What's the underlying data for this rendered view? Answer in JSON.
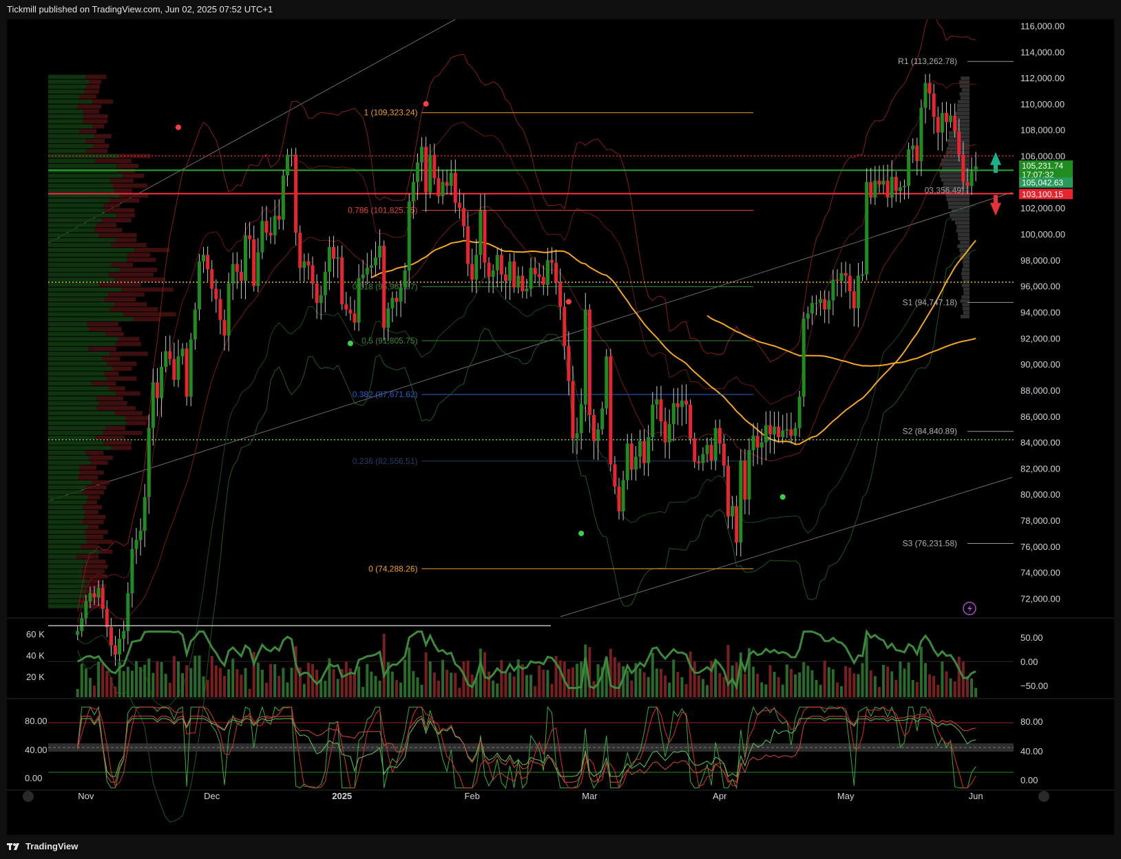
{
  "header": {
    "text": "Tickmill published on TradingView.com, Jun 02, 2025 07:52 UTC+1"
  },
  "footer": {
    "brand": "TradingView"
  },
  "colors": {
    "up": "#1e8c1e",
    "down": "#e8252e",
    "grid": "#1c1c1c",
    "fib_orange": "#f0a020",
    "fib_red": "#e8403a",
    "fib_green": "#3a8a3a",
    "fib_blue": "#2a5fd0",
    "fib_dark": "#20406a",
    "ma_orange": "#f5a623",
    "bb_red": "#8a1c1c",
    "bb_green": "#1f5a1f",
    "channel": "#8a8a8a"
  },
  "chart_data": [
    {
      "type": "candlestick",
      "symbol_note": "BTC daily",
      "price_axis": {
        "ticks": [
          "116,000.00",
          "114,000.00",
          "112,000.00",
          "110,000.00",
          "108,000.00",
          "106,000.00",
          "104,000.00",
          "102,000.00",
          "100,000.00",
          "98,000.00",
          "96,000.00",
          "94,000.00",
          "92,000.00",
          "90,000.00",
          "88,000.00",
          "86,000.00",
          "84,000.00",
          "82,000.00",
          "80,000.00",
          "78,000.00",
          "76,000.00",
          "74,000.00",
          "72,000.00"
        ],
        "ylim": [
          70600,
          116500
        ]
      },
      "time_axis": {
        "labels": [
          "Nov",
          "Dec",
          "2025",
          "Feb",
          "Mar",
          "Apr",
          "May",
          "Jun"
        ],
        "xlim": [
          "2024-10-23",
          "2025-06-10"
        ]
      },
      "price_labels": [
        {
          "text": "105,231.74",
          "sub": "17:07:32",
          "value": 105231.74,
          "color": "#1e8c1e"
        },
        {
          "text": "105,042.63",
          "value": 105042.63,
          "color": "#2a9a5a"
        },
        {
          "text": "103,100.15",
          "value": 103100.15,
          "color": "#e8252e"
        }
      ],
      "fib_levels": [
        {
          "label": "1 (109,323.24)",
          "value": 109323.24,
          "color": "#f0a020"
        },
        {
          "label": "0.786 (101,825.75)",
          "value": 101825.75,
          "color": "#e8403a"
        },
        {
          "label": "0.618 (95,961.87)",
          "value": 95961.87,
          "color": "#3a8a3a"
        },
        {
          "label": "0.5 (91,805.75)",
          "value": 91805.75,
          "color": "#3a8a3a"
        },
        {
          "label": "0.382 (87,671.62)",
          "value": 87671.62,
          "color": "#2a5fd0"
        },
        {
          "label": "0.236 (82,556.51)",
          "value": 82556.51,
          "color": "#20406a"
        },
        {
          "label": "0 (74,288.26)",
          "value": 74288.26,
          "color": "#f0a020"
        }
      ],
      "pivots": [
        {
          "label": "R1 (113,262.78)",
          "value": 113262.78
        },
        {
          "label": "S1 (94,747.18)",
          "value": 94747.18
        },
        {
          "label": "S2 (84,840.89)",
          "value": 84840.89
        },
        {
          "label": "S3 (76,231.58)",
          "value": 76231.58
        }
      ],
      "overlapped_label": {
        "text": "03,356.49)",
        "value": 103356.49
      },
      "horizontal_lines": [
        {
          "value": 106000,
          "style": "dotted",
          "color": "#e8252e"
        },
        {
          "value": 104900,
          "style": "solid",
          "color": "#2aaa2a"
        },
        {
          "value": 103100,
          "style": "solid",
          "color": "#ff3040"
        },
        {
          "value": 96300,
          "style": "dotted",
          "color": "#f0c020"
        },
        {
          "value": 84200,
          "style": "dotted",
          "color": "#6ad04a"
        }
      ],
      "candles_close": [
        69500,
        70500,
        71800,
        72400,
        72100,
        72800,
        71200,
        69800,
        68400,
        67700,
        68900,
        69500,
        72400,
        75800,
        76500,
        77200,
        79800,
        85100,
        88600,
        87400,
        89800,
        91000,
        90400,
        88800,
        90600,
        91200,
        87500,
        91900,
        94200,
        97900,
        98400,
        97300,
        95800,
        95000,
        93400,
        92200,
        96200,
        97700,
        97100,
        96400,
        99900,
        99600,
        96000,
        98600,
        101000,
        100100,
        99900,
        101400,
        101100,
        104500,
        106100,
        106100,
        100100,
        97400,
        97900,
        97600,
        96200,
        94700,
        95300,
        97100,
        99000,
        98100,
        98200,
        94600,
        94200,
        93900,
        93200,
        96600,
        96900,
        97400,
        97600,
        98200,
        99100,
        92800,
        94300,
        95100,
        94800,
        95900,
        97200,
        102500,
        104000,
        105500,
        106700,
        103200,
        106100,
        104300,
        102900,
        104000,
        103700,
        104700,
        102400,
        102000,
        100600,
        97700,
        96500,
        98400,
        101800,
        97800,
        96700,
        97200,
        98400,
        96900,
        96400,
        97900,
        95900,
        96800,
        95600,
        95800,
        97400,
        96900,
        96700,
        96100,
        98000,
        97800,
        96300,
        94400,
        91400,
        88700,
        84300,
        84700,
        86900,
        94200,
        86100,
        84100,
        85000,
        86600,
        90600,
        82300,
        80600,
        78700,
        81100,
        83900,
        81900,
        82900,
        84100,
        82400,
        84400,
        86900,
        87300,
        85600,
        84000,
        85400,
        87000,
        86700,
        87200,
        86900,
        84300,
        82500,
        82400,
        83100,
        83800,
        82600,
        85100,
        83900,
        82200,
        78300,
        79100,
        76300,
        82600,
        79600,
        83400,
        84500,
        83600,
        84000,
        85300,
        84600,
        85200,
        84400,
        84900,
        85000,
        84500,
        85100,
        87500,
        93500,
        93900,
        94700,
        94700,
        95000,
        94200,
        94900,
        96500,
        96400,
        97000,
        96800,
        95600,
        94300,
        96800,
        96900,
        104000,
        102800,
        104100,
        103800,
        104100,
        102800,
        104400,
        103300,
        103600,
        103700,
        106500,
        106800,
        105600,
        109700,
        111600,
        110800,
        109000,
        107800,
        109300,
        108600,
        109100,
        107900,
        106100,
        104000,
        103700,
        104800,
        105200
      ]
    },
    {
      "type": "bar+line",
      "name": "volume-and-oscillator",
      "left_axis_ticks": [
        "60 K",
        "40 K",
        "20 K"
      ],
      "right_axis_ticks": [
        "50.00",
        "0.00",
        "−50.00"
      ]
    },
    {
      "type": "line",
      "name": "stochastic-rsi",
      "left_axis_ticks": [
        "80.00",
        "40.00",
        "0.00"
      ],
      "right_axis_ticks": [
        "80.00",
        "40.00",
        "0.00"
      ],
      "levels": [
        80,
        50,
        20
      ]
    }
  ]
}
